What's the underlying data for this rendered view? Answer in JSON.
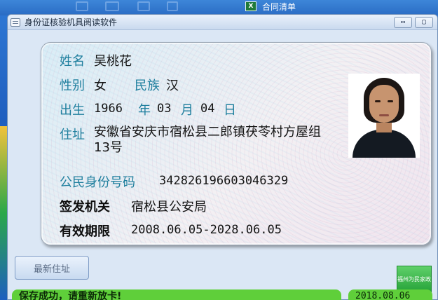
{
  "taskbar": {
    "item_label": "合同清单",
    "item_icon": "excel-icon"
  },
  "window": {
    "title": "身份证核验机具阅读软件",
    "min_symbol": "▭",
    "max_symbol": "▢"
  },
  "card": {
    "name_label": "姓名",
    "name": "吴桃花",
    "gender_label": "性别",
    "gender": "女",
    "ethnic_label": "民族",
    "ethnic": "汉",
    "birth_label": "出生",
    "birth_year": "1966",
    "year_unit": "年",
    "birth_month": "03",
    "month_unit": "月",
    "birth_day": "04",
    "day_unit": "日",
    "address_label": "住址",
    "address": "安徽省安庆市宿松县二郎镇茯苓村方屋组13号",
    "id_label": "公民身份号码",
    "id_number": "342826196603046329",
    "authority_label": "签发机关",
    "authority": "宿松县公安局",
    "validity_label": "有效期限",
    "validity": "2008.06.05-2028.06.05"
  },
  "controls": {
    "latest_address_button": "最新住址",
    "badge_text": "福州为民家政"
  },
  "status": {
    "message": "保存成功，请重新放卡!",
    "date": "2018.08.06"
  },
  "colors": {
    "label": "#1f7f9e",
    "status_green": "#5fcf3a"
  }
}
